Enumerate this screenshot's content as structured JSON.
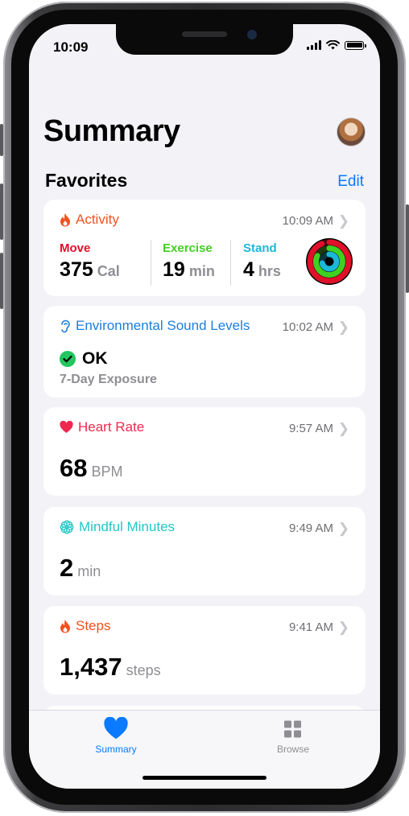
{
  "status_bar": {
    "time": "10:09"
  },
  "header": {
    "title": "Summary"
  },
  "favorites": {
    "label": "Favorites",
    "edit_label": "Edit"
  },
  "cards": {
    "activity": {
      "title": "Activity",
      "time": "10:09 AM",
      "move": {
        "label": "Move",
        "value": "375",
        "unit": "Cal"
      },
      "exercise": {
        "label": "Exercise",
        "value": "19",
        "unit": "min"
      },
      "stand": {
        "label": "Stand",
        "value": "4",
        "unit": "hrs"
      }
    },
    "sound": {
      "title": "Environmental Sound Levels",
      "time": "10:02 AM",
      "status": "OK",
      "subtitle": "7-Day Exposure"
    },
    "heart": {
      "title": "Heart Rate",
      "time": "9:57 AM",
      "value": "68",
      "unit": "BPM"
    },
    "mindful": {
      "title": "Mindful Minutes",
      "time": "9:49 AM",
      "value": "2",
      "unit": "min"
    },
    "steps": {
      "title": "Steps",
      "time": "9:41 AM",
      "value": "1,437",
      "unit": "steps"
    }
  },
  "tabbar": {
    "summary_label": "Summary",
    "browse_label": "Browse"
  },
  "colors": {
    "activity": "#f4511e",
    "move": "#e0102a",
    "exercise": "#40d020",
    "stand": "#1ab8d8",
    "sound": "#1a7fe0",
    "heart": "#f02850",
    "mindful": "#22c6c6",
    "steps": "#f4511e",
    "link": "#0a7aff",
    "ok": "#22c55e"
  },
  "icons": {
    "activity": "flame-icon",
    "sound": "ear-icon",
    "heart": "heart-icon",
    "mindful": "flower-icon",
    "steps": "flame-icon",
    "chevron": "chevron-right-icon",
    "summary_tab": "heart-icon",
    "browse_tab": "grid-icon"
  }
}
